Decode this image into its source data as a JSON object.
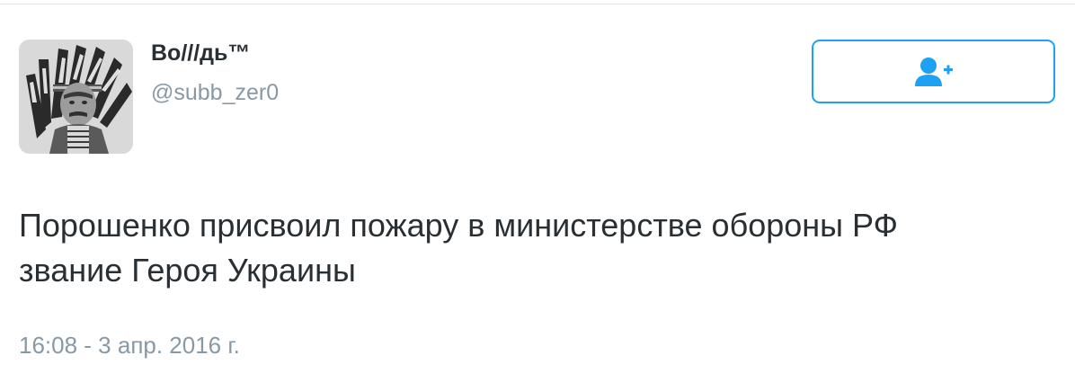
{
  "tweet": {
    "author": {
      "display_name": "Во///дь™",
      "handle": "@subb_zer0",
      "avatar_icon": "avatar-portrait-feather-headdress"
    },
    "follow_button": {
      "icon": "follow-user-plus-icon",
      "accent_color": "#1da1f2"
    },
    "text_lines": [
      "Порошенко присвоил пожару в министерстве обороны РФ",
      "звание Героя Украины"
    ],
    "timestamp": "16:08 - 3 апр. 2016 г."
  },
  "colors": {
    "text": "#292f33",
    "secondary_text": "#8899a6",
    "accent": "#1da1f2",
    "divider": "#e1e8ed"
  }
}
